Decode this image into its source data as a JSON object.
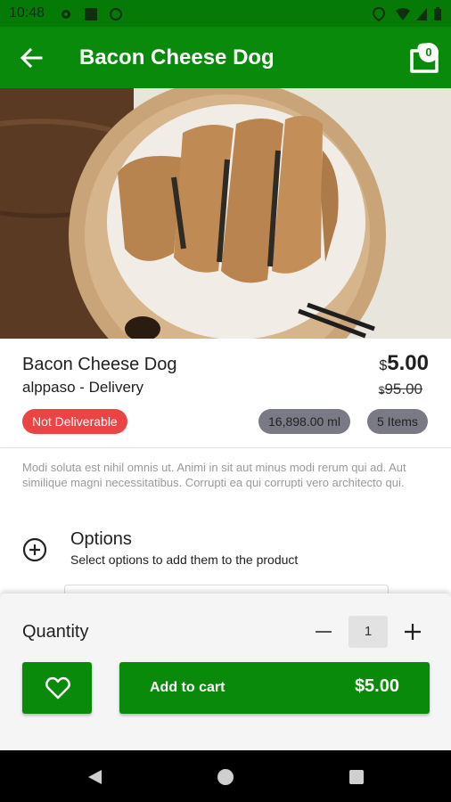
{
  "status_bar": {
    "time": "10:48"
  },
  "app_bar": {
    "title": "Bacon Cheese Dog",
    "cart_count": "0"
  },
  "product": {
    "name": "Bacon Cheese Dog",
    "vendor": "alppaso - Delivery",
    "currency": "$",
    "price": "5.00",
    "old_price": "95.00",
    "badges": {
      "availability": "Not Deliverable",
      "capacity": "16,898.00 ml",
      "items": "5 Items"
    },
    "description": "Modi soluta est nihil omnis ut. Animi in sit aut minus modi rerum qui ad. Aut similique magni necessitatibus. Corrupti ea qui corrupti vero architecto qui."
  },
  "options": {
    "title": "Options",
    "subtitle": "Select options to add them to the product"
  },
  "quantity": {
    "label": "Quantity",
    "value": "1"
  },
  "actions": {
    "add_to_cart": "Add to cart",
    "total": "$5.00"
  },
  "colors": {
    "primary": "#0a8a0a",
    "status_bar": "#067a06",
    "badge_red": "#ea4444",
    "badge_grey": "#7a7a86"
  },
  "icons": [
    "back-arrow-icon",
    "cart-icon",
    "add-circle-icon",
    "minus-icon",
    "plus-icon",
    "heart-icon",
    "nav-back-icon",
    "nav-home-icon",
    "nav-recents-icon"
  ]
}
